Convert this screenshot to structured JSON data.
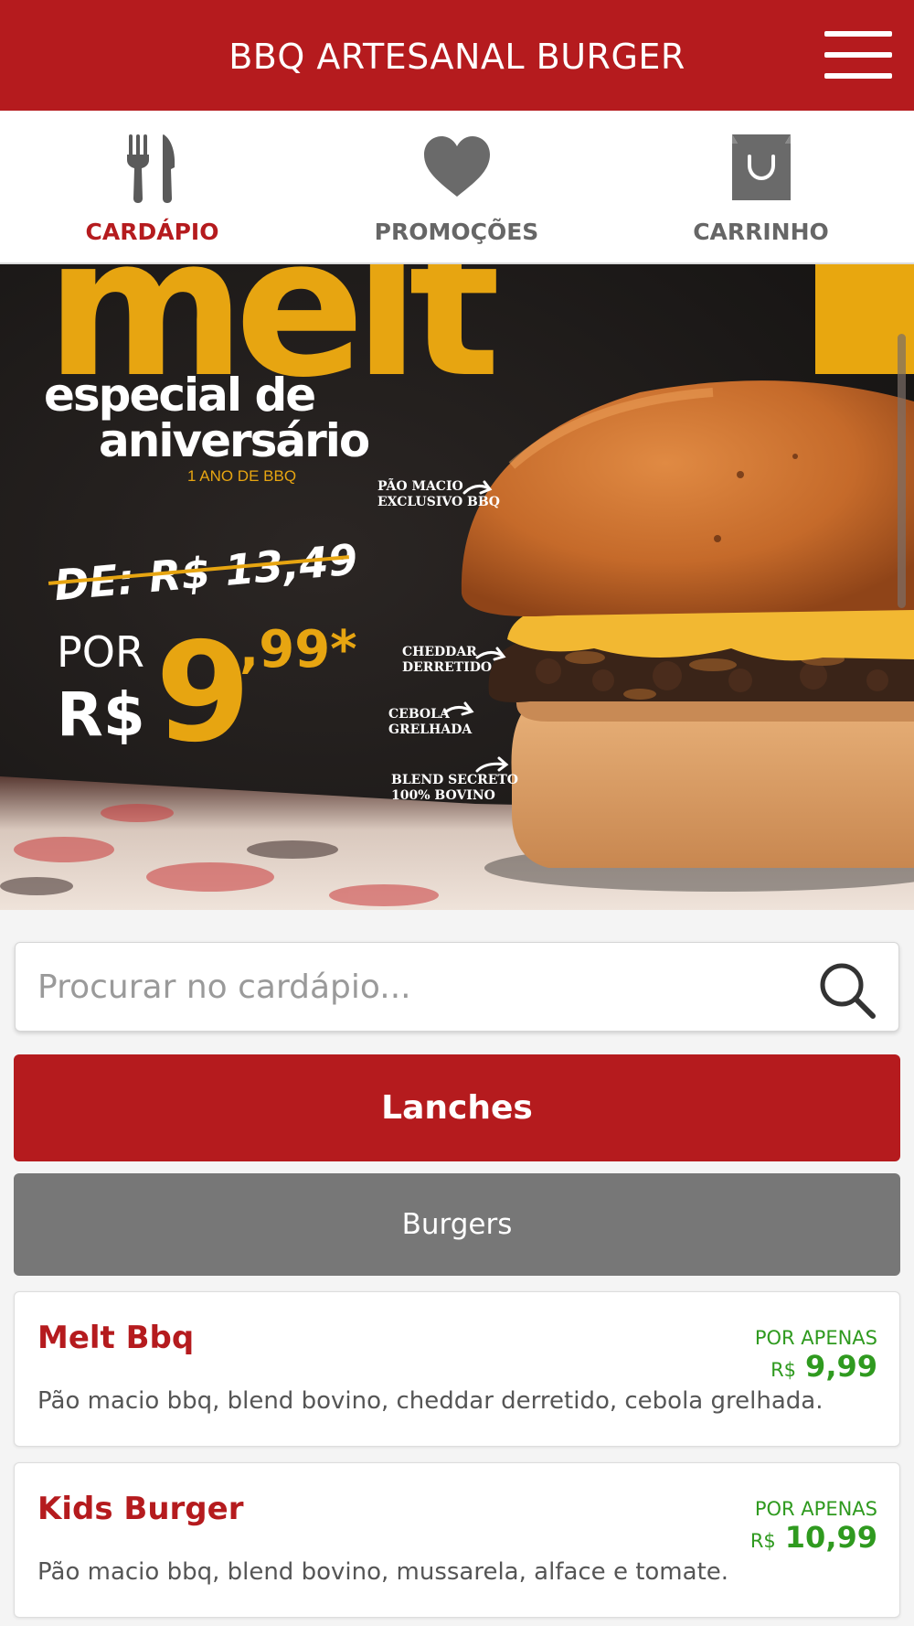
{
  "header": {
    "title": "BBQ ARTESANAL BURGER",
    "menu_icon": "hamburger-menu-icon"
  },
  "tabs": [
    {
      "label": "CARDÁPIO",
      "icon": "fork-knife-icon",
      "active": true
    },
    {
      "label": "PROMOÇÕES",
      "icon": "heart-icon",
      "active": false
    },
    {
      "label": "CARRINHO",
      "icon": "shopping-bag-icon",
      "active": false
    }
  ],
  "banner": {
    "headline": "melt",
    "subtitle_line1": "especial de",
    "subtitle_line2": "aniversário",
    "tagline": "1 ANO DE BBQ",
    "old_price": "DE: R$ 13,49",
    "por": "POR",
    "currency": "R$",
    "new_price_int": "9",
    "new_price_cents": ",99*",
    "callouts": [
      "PÃO MACIO",
      "EXCLUSIVO BBQ",
      "CHEDDAR",
      "DERRETIDO",
      "CEBOLA",
      "GRELHADA",
      "BLEND SECRETO",
      "100% BOVINO"
    ]
  },
  "search": {
    "placeholder": "Procurar no cardápio...",
    "icon": "search-icon"
  },
  "categories": {
    "main": "Lanches",
    "sub": "Burgers"
  },
  "items": [
    {
      "name": "Melt Bbq",
      "description": "Pão macio bbq, blend bovino, cheddar derretido, cebola grelhada.",
      "price_label": "POR APENAS",
      "currency": "R$",
      "price": "9,99"
    },
    {
      "name": "Kids Burger",
      "description": "Pão macio bbq, blend bovino, mussarela, alface e tomate.",
      "price_label": "POR APENAS",
      "currency": "R$",
      "price": "10,99"
    }
  ],
  "colors": {
    "brand_red": "#b51b1e",
    "price_green": "#2f9a1f",
    "tab_gray": "#666666",
    "category_gray": "#777777",
    "banner_gold": "#f0ad12"
  }
}
